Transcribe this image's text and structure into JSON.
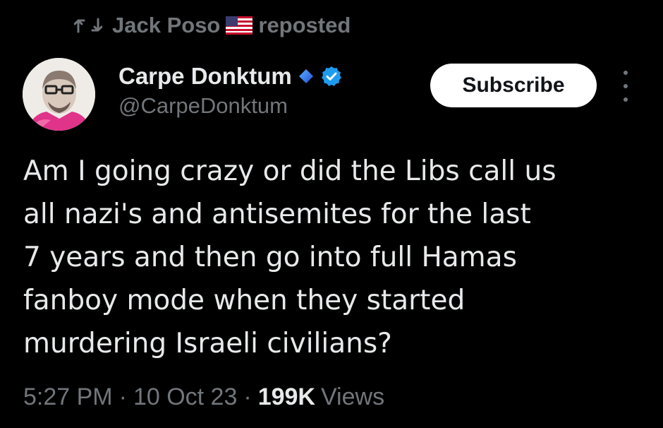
{
  "repost": {
    "icon": "repost-icon",
    "user_name": "Jack Poso",
    "flag": "us-flag-icon",
    "action_label": "reposted"
  },
  "author": {
    "display_name": "Carpe Donktum",
    "handle": "@CarpeDonktum",
    "badges": [
      "diamond-icon",
      "verified-icon"
    ],
    "avatar": "avatar-image"
  },
  "actions": {
    "subscribe_label": "Subscribe",
    "more_icon": "more-icon"
  },
  "tweet": {
    "lines": [
      "Am I going crazy or did the Libs call us",
      "all nazi's and antisemites for the last",
      "7 years and then go into full Hamas",
      "fanboy mode when they started",
      "murdering Israeli civilians?"
    ]
  },
  "meta": {
    "time": "5:27 PM",
    "date": "10 Oct 23",
    "separator": "·",
    "views_count": "199K",
    "views_label": "Views"
  },
  "colors": {
    "background": "#000000",
    "primary_text": "#e7e9ea",
    "secondary_text": "#71767b",
    "verified_blue": "#1d9bf0",
    "subscribe_bg": "#ffffff"
  }
}
